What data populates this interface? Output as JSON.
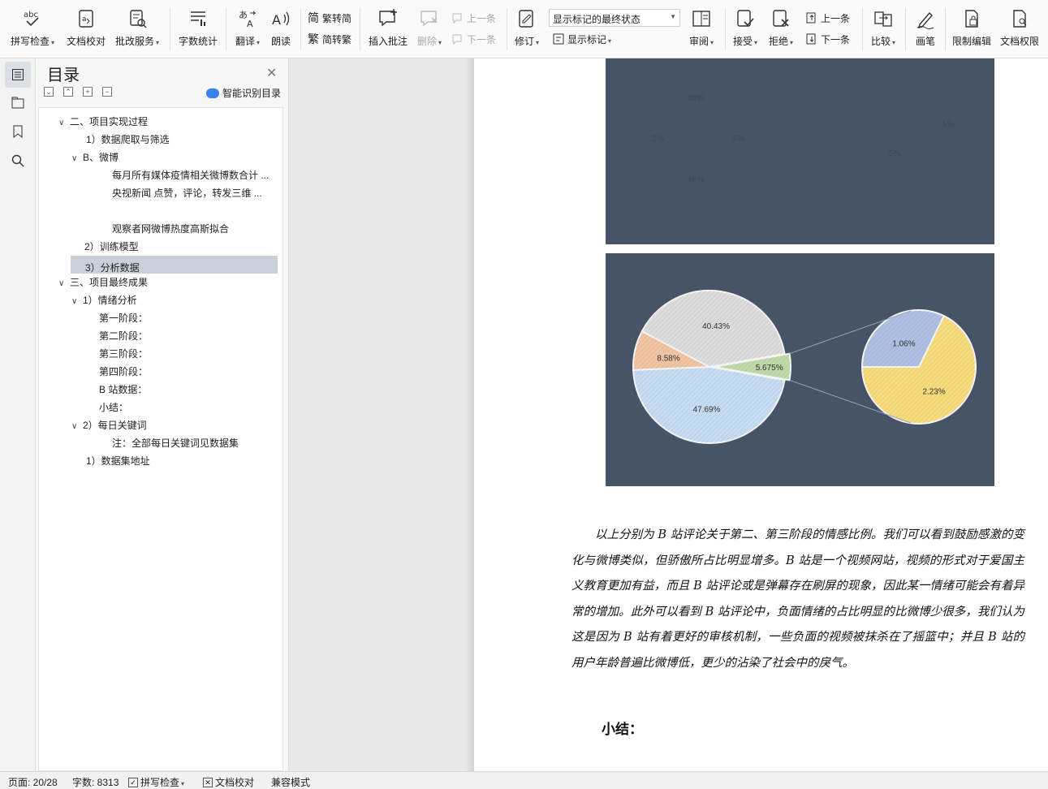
{
  "ribbon": {
    "spell_check": "拼写检查",
    "doc_proof": "文档校对",
    "correction_service": "批改服务",
    "word_count": "字数统计",
    "translate": "翻译",
    "read_aloud": "朗读",
    "trad_to_simp": "繁转简",
    "simp_to_trad": "简转繁",
    "insert_comment": "插入批注",
    "delete": "删除",
    "prev_comment": "上一条",
    "next_comment": "下一条",
    "revise": "修订",
    "markup_select": "显示标记的最终状态",
    "show_markup": "显示标记",
    "review": "审阅",
    "accept": "接受",
    "reject": "拒绝",
    "prev_change": "上一条",
    "next_change": "下一条",
    "compare": "比较",
    "pen": "画笔",
    "restrict_edit": "限制编辑",
    "doc_permission": "文档权限"
  },
  "toc": {
    "title": "目录",
    "smart_recognize": "智能识别目录",
    "items": [
      {
        "label": "二、项目实现过程",
        "chevron": "v"
      },
      {
        "label": "1）数据爬取与筛选",
        "chevron": ""
      },
      {
        "label": "B、微博",
        "chevron": "v"
      },
      {
        "label": "每月所有媒体疫情相关微博数合计 ...",
        "chevron": ""
      },
      {
        "label": "央视新闻 点赞，评论，转发三维 ...",
        "chevron": ""
      },
      {
        "label": "观察者网微博热度高斯拟合",
        "chevron": ""
      },
      {
        "label": "2）训练模型",
        "chevron": ""
      },
      {
        "label": "3）分析数据",
        "chevron": ""
      },
      {
        "label": "三、项目最终成果",
        "chevron": "v"
      },
      {
        "label": "1）情绪分析",
        "chevron": "v"
      },
      {
        "label": "第一阶段：",
        "chevron": ""
      },
      {
        "label": "第二阶段：",
        "chevron": ""
      },
      {
        "label": "第三阶段：",
        "chevron": ""
      },
      {
        "label": "第四阶段：",
        "chevron": ""
      },
      {
        "label": "B 站数据：",
        "chevron": ""
      },
      {
        "label": "小结：",
        "chevron": ""
      },
      {
        "label": "2）每日关键词",
        "chevron": "v"
      },
      {
        "label": "注：全部每日关键词见数据集",
        "chevron": ""
      },
      {
        "label": "1）数据集地址",
        "chevron": ""
      }
    ]
  },
  "document": {
    "paragraph_lines": [
      "以上分别为 B 站评论关于第二、第三阶段的情感比例。我们可以看到鼓励感",
      "激的变化与微博类似，但骄傲所占比明显增多。B 站是一个视频网站，视频的形",
      "式对于爱国主义教育更加有益，而且 B 站评论或是弹幕存在刷屏的现象，因此某",
      "一情绪可能会有着异常的增加。此外可以看到 B 站评论中，负面情绪的占比明显",
      "的比微博少很多，我们认为这是因为 B 站有着更好的审核机制，一些负面的视频",
      "被抹杀在了摇篮中；并且 B 站的用户年龄普遍比微博低，更少的沾染了社会中的",
      "戾气。"
    ],
    "heading": "小结："
  },
  "chart_data": [
    {
      "type": "pie",
      "title": "",
      "labels": [],
      "values": [
        46,
        2,
        6,
        46,
        1,
        5
      ],
      "value_labels": [
        "46%",
        "2%",
        "6%",
        "46%",
        "1%",
        "5%"
      ],
      "note": ""
    },
    {
      "type": "pie",
      "title": "",
      "main_slices": [
        {
          "label": "47.69%",
          "value": 47.69,
          "color": "#c6dcf3"
        },
        {
          "label": "8.58%",
          "value": 8.58,
          "color": "#f2c4a2"
        },
        {
          "label": "40.43%",
          "value": 40.43,
          "color": "#dcdcdc"
        },
        {
          "label": "5.675%",
          "value": 5.675,
          "color": "#bfd9a8"
        }
      ],
      "sub_slices": [
        {
          "label": "2.23%",
          "value": 2.23,
          "color": "#f8dc7c"
        },
        {
          "label": "1.06%",
          "value": 1.06,
          "color": "#aebfe3"
        }
      ],
      "colors": {
        "background": "#475468"
      }
    }
  ],
  "status": {
    "page": "页面: 20/28",
    "word_count": "字数: 8313",
    "spell_check": "拼写检查",
    "doc_proof": "文档校对",
    "compat_mode": "兼容模式"
  }
}
